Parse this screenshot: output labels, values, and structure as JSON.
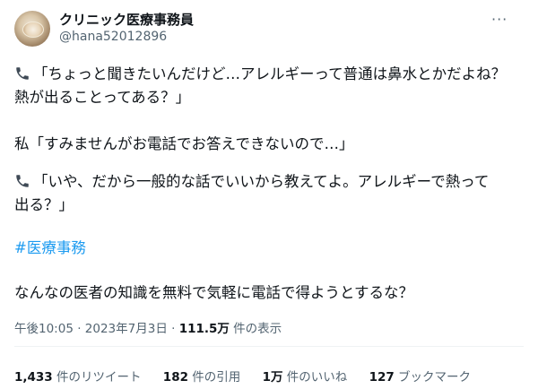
{
  "author": {
    "name": "クリニック医療事務員",
    "handle": "@hana52012896"
  },
  "more_label": "···",
  "tweet": {
    "line1": "「ちょっと聞きたいんだけど…アレルギーって普通は鼻水とかだよね？",
    "line2": "熱が出ることってある？」",
    "line3": "私「すみませんがお電話でお答えできないので…」",
    "line4": "「いや、だから一般的な話でいいから教えてよ。アレルギーで熱って",
    "line5": "出る？」",
    "hashtag": "#医療事務",
    "line6": "なんなの医者の知識を無料で気軽に電話で得ようとするな？"
  },
  "meta": {
    "time": "午後10:05 · 2023年7月3日 · ",
    "views": "111.5万",
    "views_label": " 件の表示"
  },
  "stats": {
    "retweets": "1,433",
    "retweets_label": " 件のリツイート",
    "quotes": "182",
    "quotes_label": " 件の引用",
    "likes": "1万",
    "likes_label": " 件のいいね",
    "bookmarks": "127",
    "bookmarks_label": " ブックマーク"
  },
  "colors": {
    "hashtag": "#1d9bf0",
    "secondary_text": "#536471",
    "divider": "#eff3f4"
  }
}
